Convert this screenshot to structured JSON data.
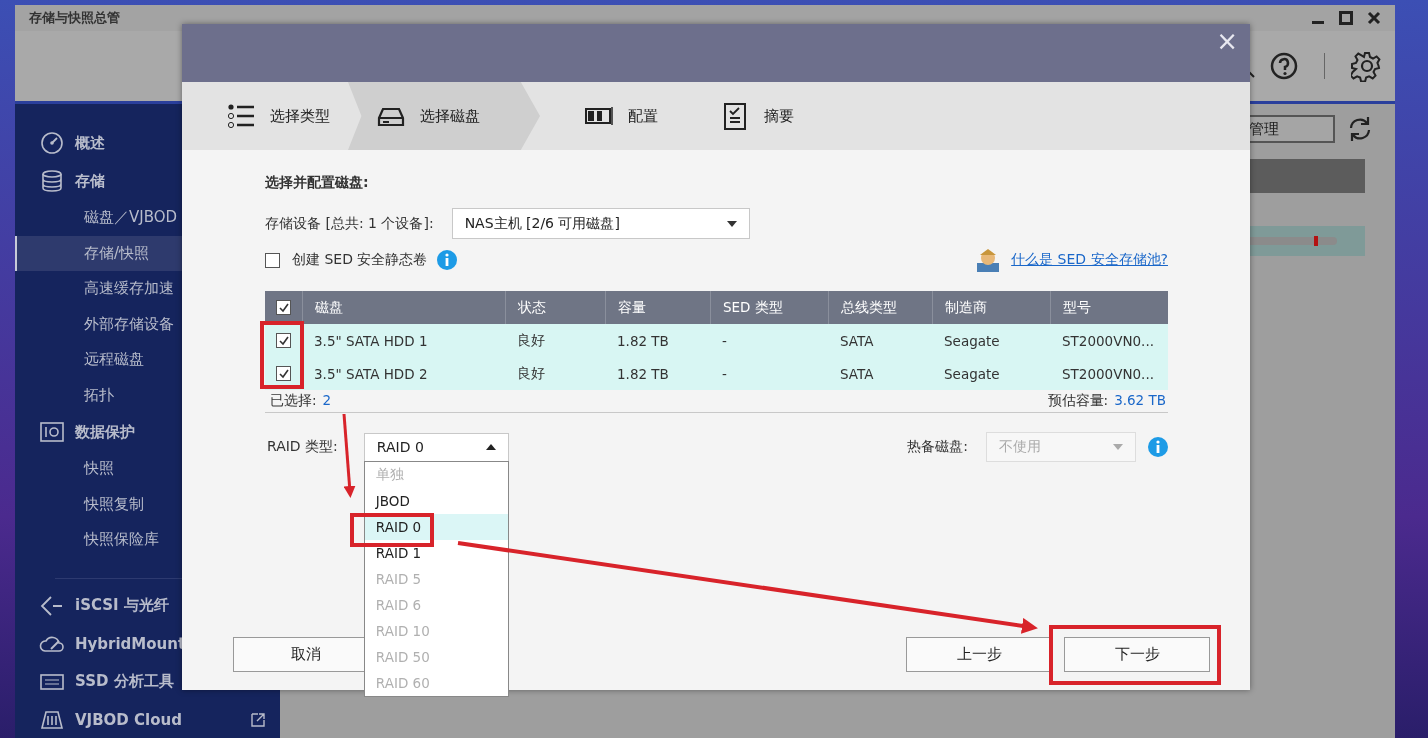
{
  "app": {
    "title": "存储与快照总管",
    "manage_button": "管理"
  },
  "sidebar": {
    "items": [
      {
        "label": "概述",
        "selected": false
      },
      {
        "label": "存储",
        "selected": false,
        "children": [
          {
            "label": "磁盘／VJBOD",
            "selected": false
          },
          {
            "label": "存储/快照",
            "selected": true
          },
          {
            "label": "高速缓存加速",
            "selected": false
          },
          {
            "label": "外部存储设备",
            "selected": false
          },
          {
            "label": "远程磁盘",
            "selected": false
          },
          {
            "label": "拓扑",
            "selected": false
          }
        ]
      },
      {
        "label": "数据保护",
        "selected": false,
        "children": [
          {
            "label": "快照",
            "selected": false
          },
          {
            "label": "快照复制",
            "selected": false
          },
          {
            "label": "快照保险库",
            "selected": false
          }
        ]
      },
      {
        "label": "iSCSI 与光纤",
        "selected": false
      },
      {
        "label": "HybridMount",
        "selected": false
      },
      {
        "label": "SSD 分析工具",
        "selected": false
      },
      {
        "label": "VJBOD Cloud",
        "selected": false
      }
    ]
  },
  "dialog": {
    "close": "×",
    "steps": [
      {
        "label": "选择类型",
        "selected": false
      },
      {
        "label": "选择磁盘",
        "selected": true
      },
      {
        "label": "配置",
        "selected": false
      },
      {
        "label": "摘要",
        "selected": false
      }
    ],
    "heading": "选择并配置磁盘:",
    "device": {
      "label": "存储设备 [总共: 1 个设备]:",
      "value": "NAS主机 [2/6 可用磁盘]"
    },
    "sed_checkbox": {
      "label": "创建 SED 安全静态卷",
      "checked": false
    },
    "sed_link": "什么是 SED 安全存储池?",
    "table": {
      "all_checked": true,
      "columns": [
        "磁盘",
        "状态",
        "容量",
        "SED 类型",
        "总线类型",
        "制造商",
        "型号"
      ],
      "rows": [
        {
          "checked": true,
          "cells": [
            "3.5\" SATA HDD 1",
            "良好",
            "1.82 TB",
            "-",
            "SATA",
            "Seagate",
            "ST2000VN0..."
          ]
        },
        {
          "checked": true,
          "cells": [
            "3.5\" SATA HDD 2",
            "良好",
            "1.82 TB",
            "-",
            "SATA",
            "Seagate",
            "ST2000VN0..."
          ]
        }
      ],
      "selected_label": "已选择:",
      "selected_count": "2",
      "capacity_label": "预估容量:",
      "capacity_value": "3.62 TB"
    },
    "raid": {
      "label": "RAID 类型:",
      "value": "RAID 0",
      "expanded": true,
      "options": [
        {
          "label": "单独",
          "disabled": true,
          "selected": false
        },
        {
          "label": "JBOD",
          "disabled": false,
          "selected": false
        },
        {
          "label": "RAID 0",
          "disabled": false,
          "selected": true
        },
        {
          "label": "RAID 1",
          "disabled": false,
          "selected": false
        },
        {
          "label": "RAID 5",
          "disabled": true,
          "selected": false
        },
        {
          "label": "RAID 6",
          "disabled": true,
          "selected": false
        },
        {
          "label": "RAID 10",
          "disabled": true,
          "selected": false
        },
        {
          "label": "RAID 50",
          "disabled": true,
          "selected": false
        },
        {
          "label": "RAID 60",
          "disabled": true,
          "selected": false
        }
      ]
    },
    "hot_spare": {
      "label": "热备磁盘:",
      "value": "不使用",
      "disabled": true
    },
    "buttons": {
      "cancel": "取消",
      "back": "上一步",
      "next": "下一步"
    }
  }
}
